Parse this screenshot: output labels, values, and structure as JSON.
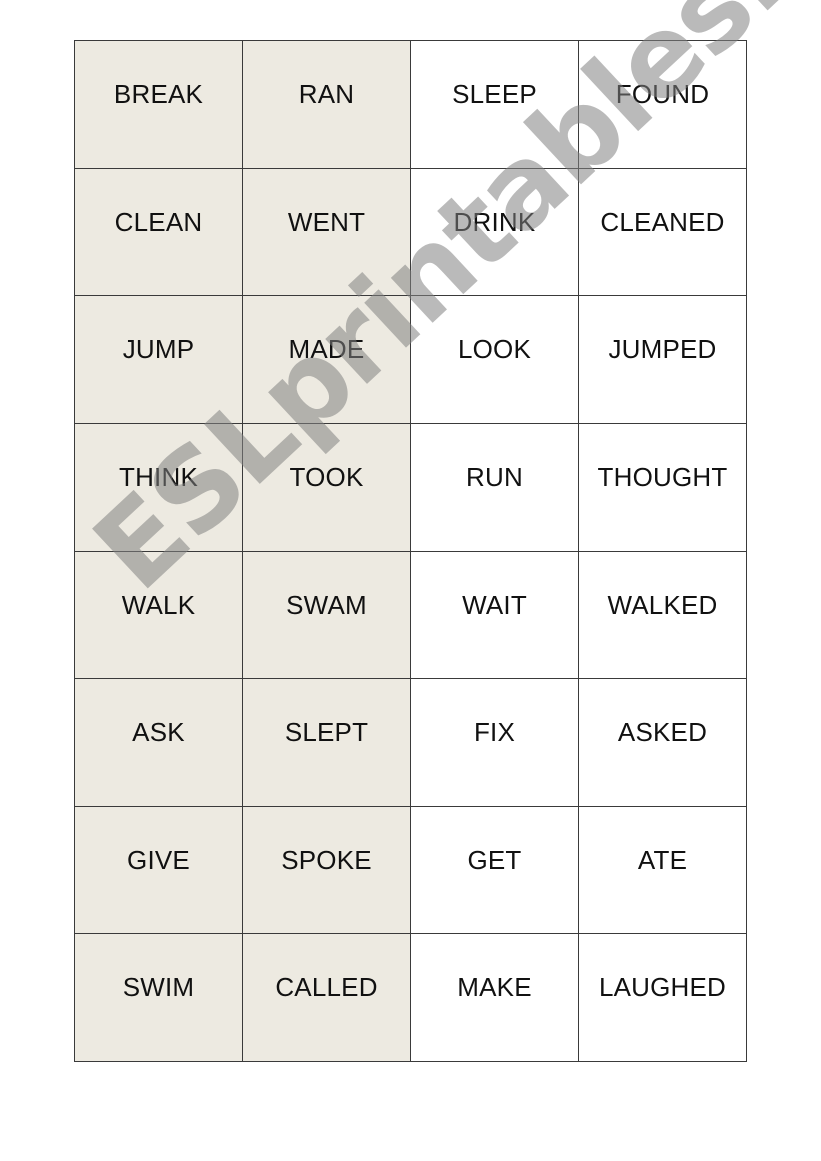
{
  "cards": {
    "rows": [
      [
        "BREAK",
        "RAN",
        "SLEEP",
        "FOUND"
      ],
      [
        "CLEAN",
        "WENT",
        "DRINK",
        "CLEANED"
      ],
      [
        "JUMP",
        "MADE",
        "LOOK",
        "JUMPED"
      ],
      [
        "THINK",
        "TOOK",
        "RUN",
        "THOUGHT"
      ],
      [
        "WALK",
        "SWAM",
        "WAIT",
        "WALKED"
      ],
      [
        "ASK",
        "SLEPT",
        "FIX",
        "ASKED"
      ],
      [
        "GIVE",
        "SPOKE",
        "GET",
        "ATE"
      ],
      [
        "SWIM",
        "CALLED",
        "MAKE",
        "LAUGHED"
      ]
    ],
    "shaded_columns": [
      0,
      1
    ],
    "shade_color": "#edeae1"
  },
  "watermark": "ESLprintables.com"
}
